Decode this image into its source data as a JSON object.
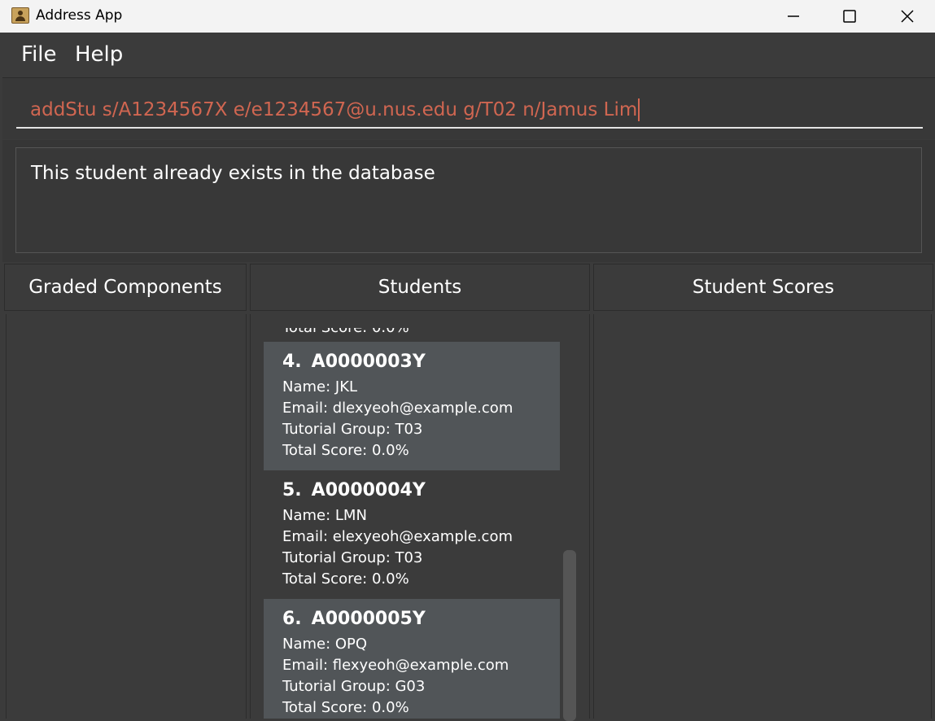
{
  "window": {
    "title": "Address App"
  },
  "menu": {
    "file": "File",
    "help": "Help"
  },
  "command": {
    "value": "addStu s/A1234567X e/e1234567@u.nus.edu g/T02 n/Jamus Lim"
  },
  "result": {
    "message": "This student already exists in the database"
  },
  "panels": {
    "graded": "Graded Components",
    "students": "Students",
    "scores": "Student Scores"
  },
  "students": {
    "partial_text": "Total Score: 0.0%",
    "cards": [
      {
        "index": "4.",
        "id": "A0000003Y",
        "name": "Name: JKL",
        "email": "Email: dlexyeoh@example.com",
        "group": "Tutorial Group: T03",
        "score": "Total Score: 0.0%"
      },
      {
        "index": "5.",
        "id": "A0000004Y",
        "name": "Name: LMN",
        "email": "Email: elexyeoh@example.com",
        "group": "Tutorial Group: T03",
        "score": "Total Score: 0.0%"
      },
      {
        "index": "6.",
        "id": "A0000005Y",
        "name": "Name: OPQ",
        "email": "Email: flexyeoh@example.com",
        "group": "Tutorial Group: G03",
        "score": "Total Score: 0.0%"
      }
    ]
  },
  "icons": {
    "app": "address-book-icon",
    "minimize": "minimize-icon",
    "maximize": "maximize-icon",
    "close": "close-icon"
  },
  "colors": {
    "accent_command_text": "#d06651",
    "card_highlight": "#515558",
    "background": "#3b3b3b"
  }
}
